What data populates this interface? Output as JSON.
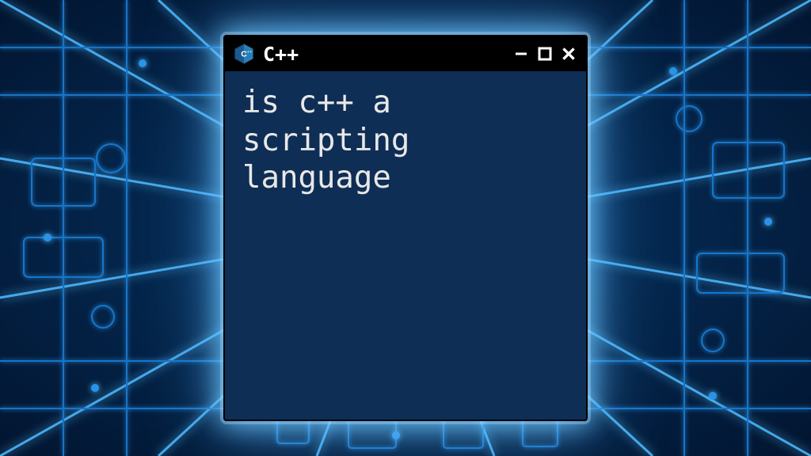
{
  "window": {
    "title": "C++",
    "icon": "cpp-icon",
    "content": "is c++ a\nscripting\nlanguage"
  },
  "controls": {
    "minimize": "−",
    "maximize": "□",
    "close": "×"
  },
  "colors": {
    "window_bg": "#0f2e55",
    "titlebar_bg": "#000000",
    "text": "#e8e8e8"
  }
}
